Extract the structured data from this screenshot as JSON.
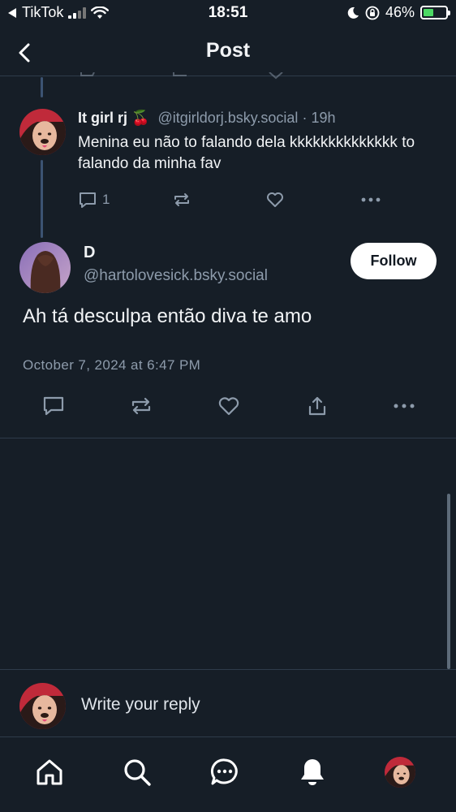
{
  "status_bar": {
    "back_app": "TikTok",
    "time": "18:51",
    "battery": "46%",
    "battery_level": 0.46
  },
  "header": {
    "title": "Post"
  },
  "reply_post": {
    "display_name": "It girl rj 🍒",
    "handle": "@itgirldorj.bsky.social",
    "separator": "·",
    "age": "19h",
    "text": "Menina eu não to falando dela kkkkkkkkkkkkkk to falando da minha fav",
    "reply_count": "1"
  },
  "main_post": {
    "display_name": "D",
    "handle": "@hartolovesick.bsky.social",
    "follow_label": "Follow",
    "text": "Ah tá desculpa então diva te amo",
    "date": "October 7, 2024 at 6:47 PM"
  },
  "compose": {
    "placeholder": "Write your reply"
  },
  "tab_bar": {
    "items": [
      "home-icon",
      "search-icon",
      "chat-icon",
      "notifications-icon",
      "profile-avatar"
    ]
  },
  "colors": {
    "background": "#161e27",
    "muted_text": "#8d9bab",
    "thread_line": "#3c5372",
    "battery_green": "#4cd964"
  }
}
